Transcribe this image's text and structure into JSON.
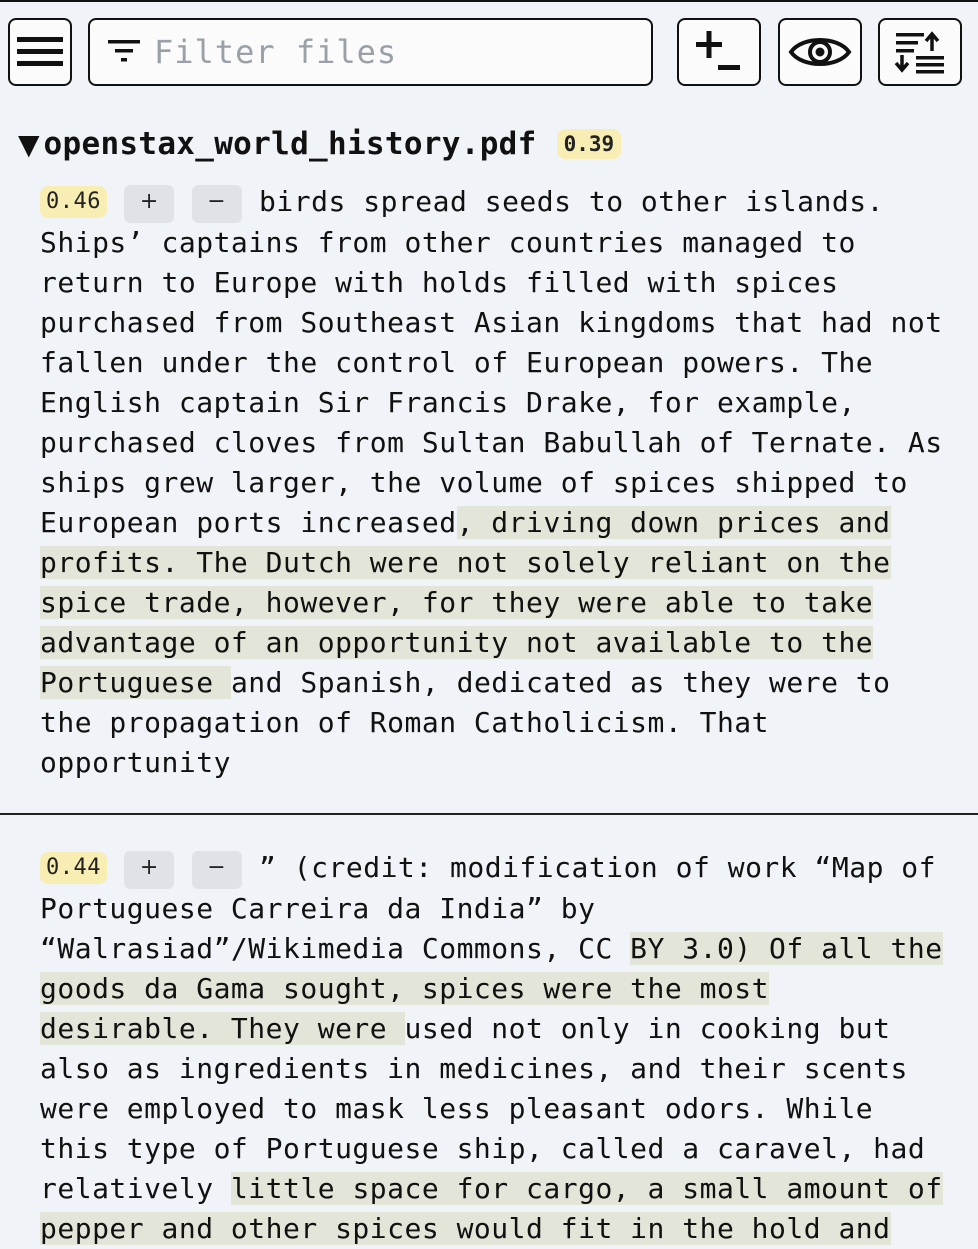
{
  "toolbar": {
    "menu_icon": "hamburger-menu-icon",
    "filter_icon": "filter-icon",
    "filter_placeholder": "Filter files",
    "filter_value": "",
    "add_icon": "plus-minus-icon",
    "view_icon": "eye-icon",
    "sort_icon": "sort-swap-icon"
  },
  "file": {
    "name": "openstax_world_history.pdf",
    "score": "0.39"
  },
  "controls": {
    "plus": "+",
    "minus": "−"
  },
  "chunks": [
    {
      "score": "0.46",
      "lines": [
        [
          {
            "t": " birds spread seeds to other islands."
          }
        ],
        [
          {
            "t": "Ships’ captains from other countries managed to"
          }
        ],
        [
          {
            "t": "return to Europe with holds filled with spices"
          }
        ],
        [
          {
            "t": "purchased from Southeast Asian kingdoms that had not"
          }
        ],
        [
          {
            "t": "fallen under the control of European powers. The"
          }
        ],
        [
          {
            "t": "English captain Sir Francis Drake, for example,"
          }
        ],
        [
          {
            "t": "purchased cloves from Sultan Babullah of Ternate. As"
          }
        ],
        [
          {
            "t": "ships grew larger, the volume of spices shipped to"
          }
        ],
        [
          {
            "t": "European ports increased"
          },
          {
            "t": ", driving down prices and",
            "hl": true
          }
        ],
        [
          {
            "t": "profits. The Dutch were not solely reliant on the",
            "hl": true
          }
        ],
        [
          {
            "t": "spice trade, however, for they were able to take",
            "hl": true
          }
        ],
        [
          {
            "t": "advantage of an opportunity not available to the",
            "hl": true
          }
        ],
        [
          {
            "t": "Portuguese ",
            "hl": true
          },
          {
            "t": "and Spanish, dedicated as they were to"
          }
        ],
        [
          {
            "t": "the propagation of Roman Catholicism. That"
          }
        ],
        [
          {
            "t": "opportunity"
          }
        ]
      ]
    },
    {
      "score": "0.44",
      "lines": [
        [
          {
            "t": " ” (credit: modification of work “Map of"
          }
        ],
        [
          {
            "t": "Portuguese Carreira da India” by"
          }
        ],
        [
          {
            "t": "“Walrasiad”/Wikimedia Commons, CC "
          },
          {
            "t": "BY 3.0) Of all the",
            "hl": true
          }
        ],
        [
          {
            "t": "goods da Gama sought, spices were the most",
            "hl": true
          }
        ],
        [
          {
            "t": "desirable. They were ",
            "hl": true
          },
          {
            "t": "used not only in cooking but"
          }
        ],
        [
          {
            "t": "also as ingredients in medicines, and their scents"
          }
        ],
        [
          {
            "t": "were employed to mask less pleasant odors. While"
          }
        ],
        [
          {
            "t": "this type of Portuguese ship, called a caravel, had"
          }
        ],
        [
          {
            "t": "relatively "
          },
          {
            "t": "little space for cargo, a small amount of",
            "hl": true
          }
        ],
        [
          {
            "t": "pepper and other spices would fit in the hold and",
            "hl": true
          }
        ]
      ]
    }
  ]
}
